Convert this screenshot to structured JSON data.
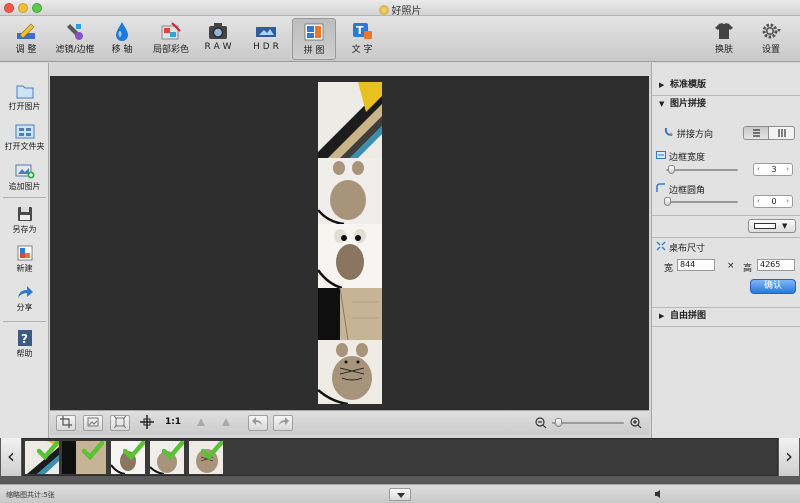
{
  "window": {
    "title": "好照片"
  },
  "toolbar": {
    "items": [
      {
        "label": "调 整",
        "icon": "adjust-pencil-icon"
      },
      {
        "label": "滤镜/边框",
        "icon": "filter-brush-icon"
      },
      {
        "label": "移 轴",
        "icon": "tilt-shift-drop-icon"
      },
      {
        "label": "局部彩色",
        "icon": "local-color-icon"
      },
      {
        "label": "R A W",
        "icon": "raw-camera-icon"
      },
      {
        "label": "H D R",
        "icon": "hdr-film-icon"
      },
      {
        "label": "拼 图",
        "icon": "collage-icon"
      },
      {
        "label": "文 字",
        "icon": "text-icon"
      },
      {
        "label": "换肤",
        "icon": "skin-shirt-icon"
      },
      {
        "label": "设置",
        "icon": "gear-icon"
      }
    ]
  },
  "sidebar": {
    "items": [
      {
        "label": "打开图片",
        "icon": "open-image-icon"
      },
      {
        "label": "打开文件夹",
        "icon": "open-folder-icon"
      },
      {
        "label": "追加图片",
        "icon": "add-image-icon"
      },
      {
        "label": "另存为",
        "icon": "save-as-icon"
      },
      {
        "label": "新建",
        "icon": "new-icon"
      },
      {
        "label": "分享",
        "icon": "share-icon"
      },
      {
        "label": "帮助",
        "icon": "help-icon"
      }
    ]
  },
  "canvas_tools": {
    "ratio_label": "1:1"
  },
  "right_panel": {
    "standard_template": "标准模版",
    "collage": "图片拼接",
    "direction_label": "拼接方向",
    "border_width_label": "边框宽度",
    "border_width_value": "3",
    "corner_label": "边框圆角",
    "corner_value": "0",
    "canvas_size_label": "桌布尺寸",
    "width_label": "宽",
    "width_value": "844",
    "times": "×",
    "height_label": "高",
    "height_value": "4265",
    "confirm_label": "确认",
    "free_collage": "自由拼图"
  },
  "status": {
    "text": "缩略图共计:5张"
  },
  "colors": {
    "accent": "#2a78e0",
    "canvas": "#2e2e2e",
    "check": "#5bc236"
  }
}
